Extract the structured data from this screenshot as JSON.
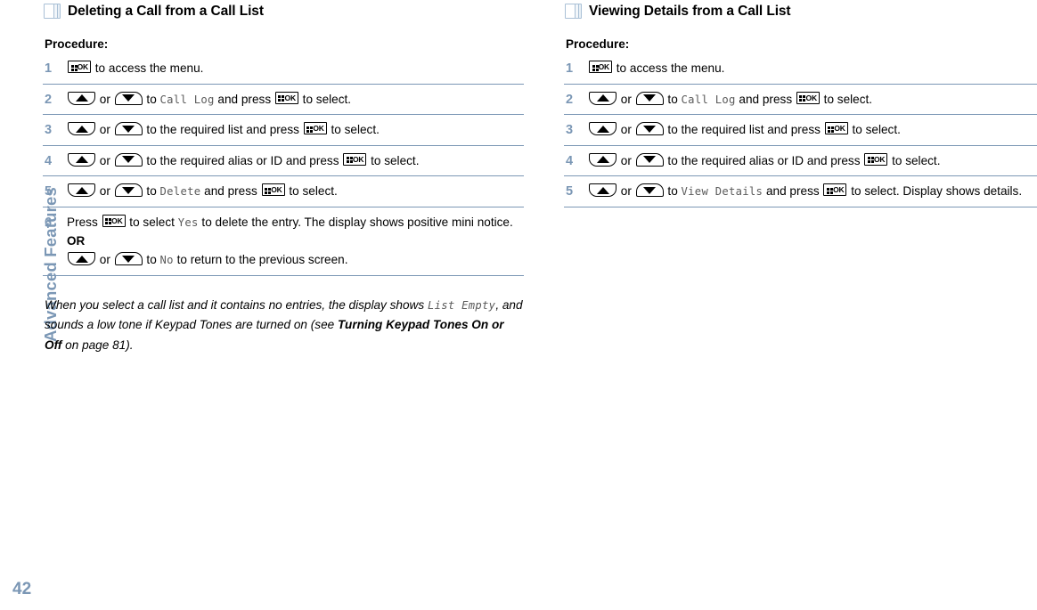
{
  "side_tab": {
    "label": "Advanced Features",
    "page_number": "42",
    "color": "#7b97b5"
  },
  "icons": {
    "pages": "pages-stack-icon",
    "ok_key": "ok-menu-key-icon",
    "up_key": "up-arrow-key-icon",
    "down_key": "down-arrow-key-icon"
  },
  "left_column": {
    "section_title": "Deleting a Call from a Call List",
    "procedure_label": "Procedure:",
    "steps": [
      {
        "num": "1",
        "parts": [
          {
            "t": "key-ok"
          },
          {
            "t": "text",
            "v": " to access the menu."
          }
        ]
      },
      {
        "num": "2",
        "parts": [
          {
            "t": "key-up"
          },
          {
            "t": "text",
            "v": " or "
          },
          {
            "t": "key-down"
          },
          {
            "t": "text",
            "v": " to "
          },
          {
            "t": "lcd",
            "v": "Call Log"
          },
          {
            "t": "text",
            "v": " and press "
          },
          {
            "t": "key-ok"
          },
          {
            "t": "text",
            "v": " to select."
          }
        ]
      },
      {
        "num": "3",
        "parts": [
          {
            "t": "key-up"
          },
          {
            "t": "text",
            "v": " or "
          },
          {
            "t": "key-down"
          },
          {
            "t": "text",
            "v": " to the required list and press "
          },
          {
            "t": "key-ok"
          },
          {
            "t": "text",
            "v": " to select."
          }
        ]
      },
      {
        "num": "4",
        "parts": [
          {
            "t": "key-up"
          },
          {
            "t": "text",
            "v": " or "
          },
          {
            "t": "key-down"
          },
          {
            "t": "text",
            "v": " to the required alias or ID and press "
          },
          {
            "t": "key-ok"
          },
          {
            "t": "text",
            "v": " to select."
          }
        ]
      },
      {
        "num": "5",
        "parts": [
          {
            "t": "key-up"
          },
          {
            "t": "text",
            "v": " or "
          },
          {
            "t": "key-down"
          },
          {
            "t": "text",
            "v": " to "
          },
          {
            "t": "lcd",
            "v": "Delete"
          },
          {
            "t": "text",
            "v": " and press "
          },
          {
            "t": "key-ok"
          },
          {
            "t": "text",
            "v": " to select."
          }
        ]
      },
      {
        "num": "6",
        "parts": [
          {
            "t": "text",
            "v": "Press "
          },
          {
            "t": "key-ok"
          },
          {
            "t": "text",
            "v": " to select "
          },
          {
            "t": "lcd",
            "v": "Yes"
          },
          {
            "t": "text",
            "v": " to delete the entry. The display shows positive mini notice."
          },
          {
            "t": "or"
          },
          {
            "t": "key-up"
          },
          {
            "t": "text",
            "v": " or "
          },
          {
            "t": "key-down"
          },
          {
            "t": "text",
            "v": " to "
          },
          {
            "t": "lcd",
            "v": "No"
          },
          {
            "t": "text",
            "v": " to return to the previous screen."
          }
        ]
      }
    ],
    "or_label": "OR",
    "note": [
      {
        "t": "i",
        "v": "When you select a call list and it contains no entries, the display shows "
      },
      {
        "t": "lcd",
        "v": "List Empty"
      },
      {
        "t": "i",
        "v": ", and sounds a low tone if Keypad Tones are turned on (see "
      },
      {
        "t": "b",
        "v": "Turning Keypad Tones On or Off"
      },
      {
        "t": "i",
        "v": " on page 81)."
      }
    ]
  },
  "right_column": {
    "section_title": "Viewing Details from a Call List",
    "procedure_label": "Procedure:",
    "steps": [
      {
        "num": "1",
        "parts": [
          {
            "t": "key-ok"
          },
          {
            "t": "text",
            "v": " to access the menu."
          }
        ]
      },
      {
        "num": "2",
        "parts": [
          {
            "t": "key-up"
          },
          {
            "t": "text",
            "v": " or "
          },
          {
            "t": "key-down"
          },
          {
            "t": "text",
            "v": " to "
          },
          {
            "t": "lcd",
            "v": "Call Log"
          },
          {
            "t": "text",
            "v": " and press "
          },
          {
            "t": "key-ok"
          },
          {
            "t": "text",
            "v": " to select."
          }
        ]
      },
      {
        "num": "3",
        "parts": [
          {
            "t": "key-up"
          },
          {
            "t": "text",
            "v": " or "
          },
          {
            "t": "key-down"
          },
          {
            "t": "text",
            "v": " to the required list and press "
          },
          {
            "t": "key-ok"
          },
          {
            "t": "text",
            "v": " to select."
          }
        ]
      },
      {
        "num": "4",
        "parts": [
          {
            "t": "key-up"
          },
          {
            "t": "text",
            "v": " or "
          },
          {
            "t": "key-down"
          },
          {
            "t": "text",
            "v": " to the required alias or ID and press "
          },
          {
            "t": "key-ok"
          },
          {
            "t": "text",
            "v": " to select."
          }
        ]
      },
      {
        "num": "5",
        "parts": [
          {
            "t": "key-up"
          },
          {
            "t": "text",
            "v": " or "
          },
          {
            "t": "key-down"
          },
          {
            "t": "text",
            "v": " to "
          },
          {
            "t": "lcd",
            "v": "View Details"
          },
          {
            "t": "text",
            "v": " and press "
          },
          {
            "t": "key-ok"
          },
          {
            "t": "text",
            "v": " to select. Display shows details."
          }
        ]
      }
    ]
  }
}
